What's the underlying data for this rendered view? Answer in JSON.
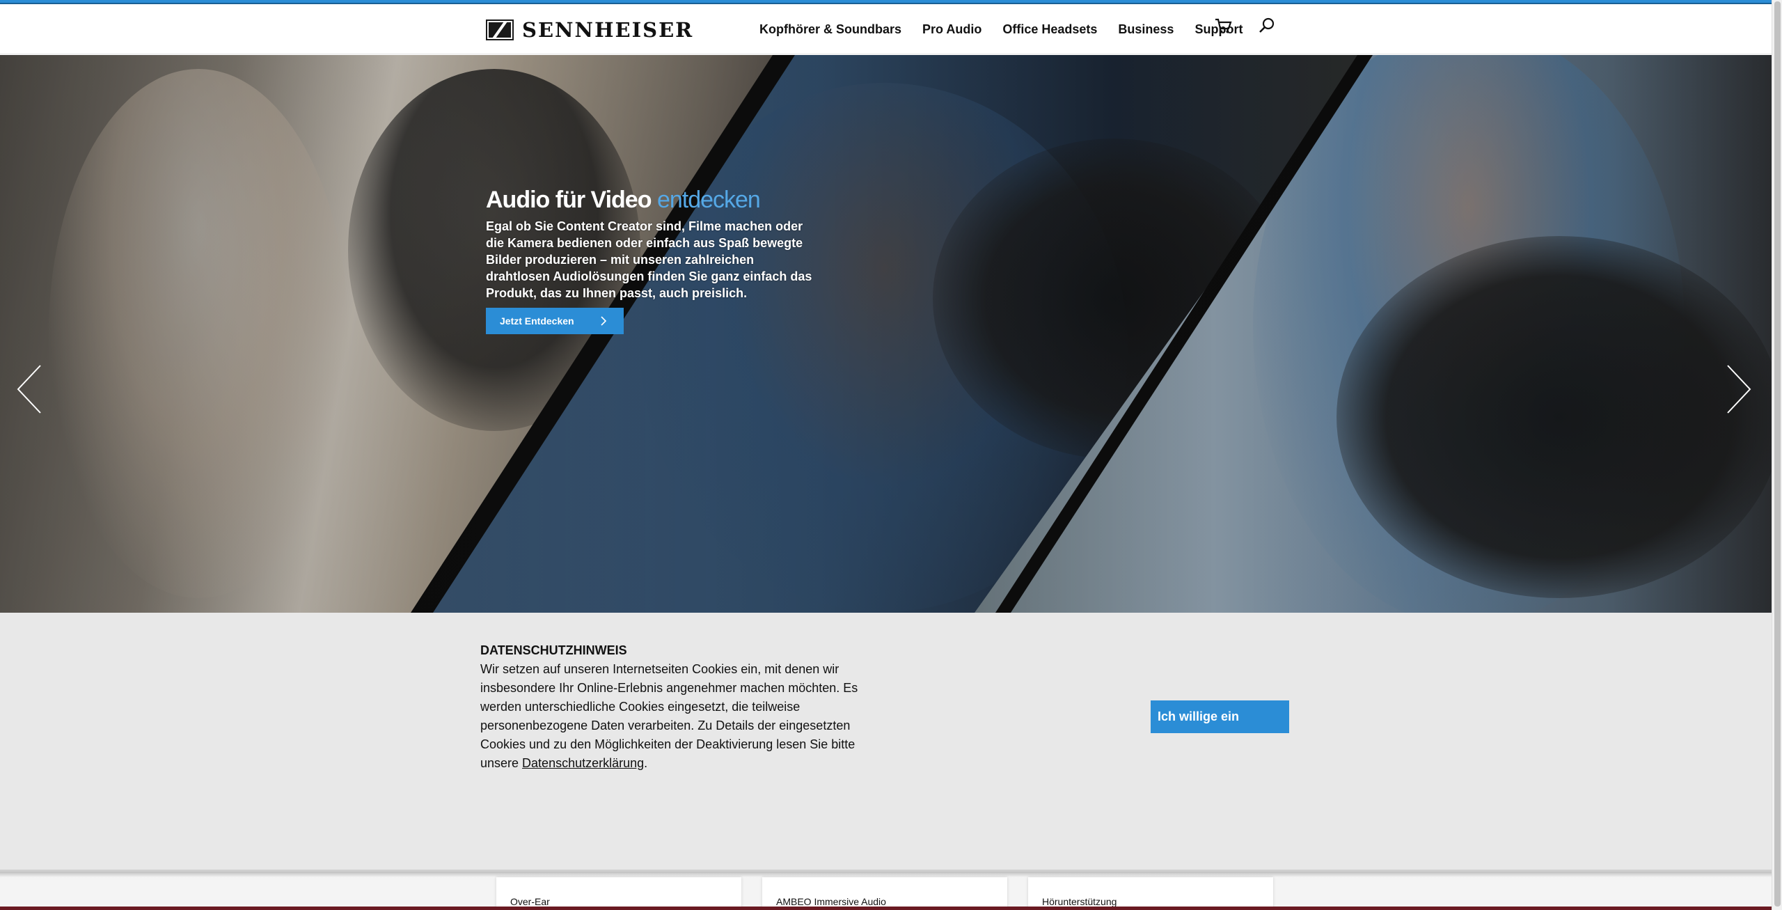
{
  "brand": {
    "name": "SENNHEISER",
    "accent_color": "#2b8dd6"
  },
  "nav": {
    "items": [
      {
        "label": "Kopfhörer & Soundbars"
      },
      {
        "label": "Pro Audio"
      },
      {
        "label": "Office Headsets"
      },
      {
        "label": "Business"
      },
      {
        "label": "Support"
      }
    ],
    "icons": [
      "cart-icon",
      "search-icon"
    ]
  },
  "hero": {
    "title_main": "Audio für Video",
    "title_accent": "entdecken",
    "description": "Egal ob Sie Content Creator sind, Filme machen oder die Kamera bedienen oder einfach aus Spaß bewegte Bilder produzieren – mit unseren zahlreichen drahtlosen Audiolösungen finden Sie ganz einfach das Produkt, das zu Ihnen passt, auch preislich.",
    "button_label": "Jetzt Entdecken"
  },
  "cookie": {
    "title": "DATENSCHUTZHINWEIS",
    "text": "Wir setzen auf unseren Internetseiten Cookies ein, mit denen wir insbesondere Ihr Online-Erlebnis angenehmer machen möchten. Es werden unterschiedliche Cookies eingesetzt, die teilweise personenbezogene Daten verarbeiten. Zu Details der eingesetzten Cookies und zu den Möglichkeiten der Deaktivierung lesen Sie bitte unsere ",
    "link_text": "Datenschutzerklärung",
    "text_end": ".",
    "accept_label": "Ich willige ein"
  },
  "categories": [
    {
      "label": "Over-Ear"
    },
    {
      "label": "AMBEO Immersive Audio"
    },
    {
      "label": "Hörunterstützung"
    }
  ]
}
